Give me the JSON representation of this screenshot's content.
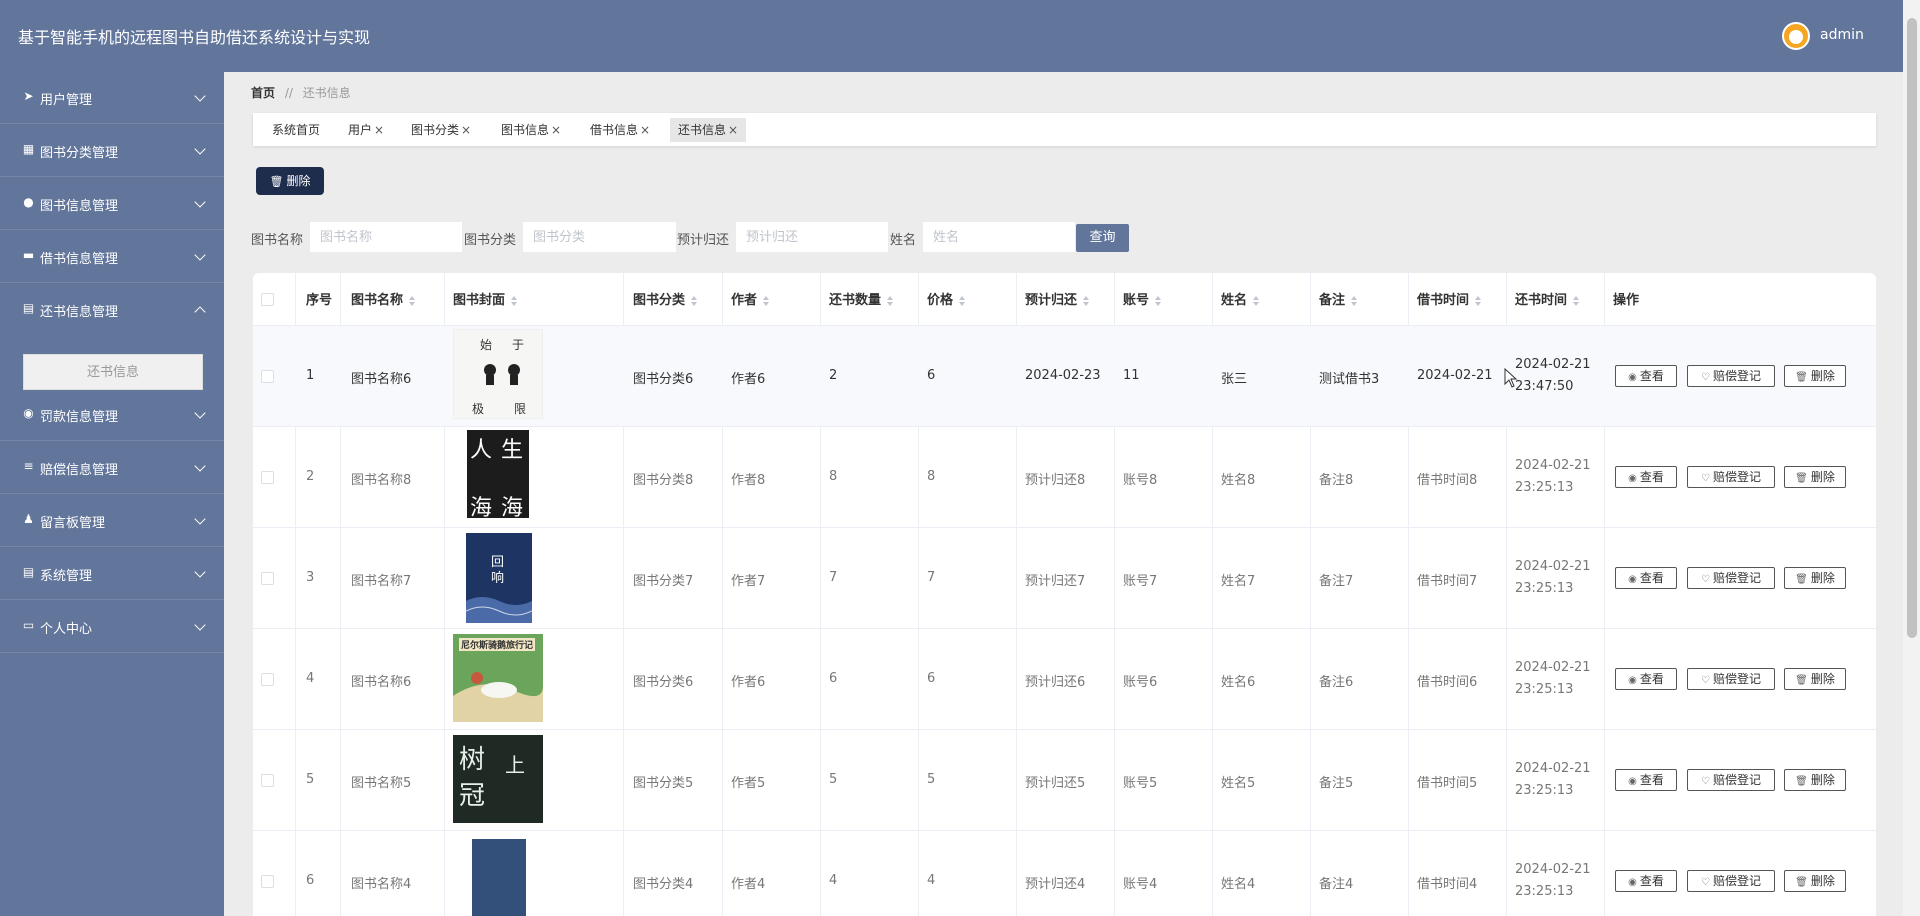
{
  "header": {
    "title": "基于智能手机的远程图书自助借还系统设计与实现",
    "username": "admin"
  },
  "sidebar": {
    "items": [
      {
        "label": "用户管理",
        "icon": "paper-plane-icon"
      },
      {
        "label": "图书分类管理",
        "icon": "grid-icon"
      },
      {
        "label": "图书信息管理",
        "icon": "map-pin-icon"
      },
      {
        "label": "借书信息管理",
        "icon": "flag-icon"
      },
      {
        "label": "还书信息管理",
        "icon": "clipboard-icon"
      },
      {
        "label": "罚款信息管理",
        "icon": "user-icon"
      },
      {
        "label": "赔偿信息管理",
        "icon": "menu-icon"
      },
      {
        "label": "留言板管理",
        "icon": "person-icon"
      },
      {
        "label": "系统管理",
        "icon": "clipboard-icon"
      },
      {
        "label": "个人中心",
        "icon": "card-icon"
      }
    ],
    "submenu": {
      "label": "还书信息"
    }
  },
  "breadcrumb": {
    "home": "首页",
    "sep": "//",
    "current": "还书信息"
  },
  "tabs": [
    {
      "label": "系统首页"
    },
    {
      "label": "用户"
    },
    {
      "label": "图书分类"
    },
    {
      "label": "图书信息"
    },
    {
      "label": "借书信息"
    },
    {
      "label": "还书信息"
    }
  ],
  "tab_close": "×",
  "toolbar": {
    "delete_label": "删除"
  },
  "search": {
    "book_name_label": "图书名称",
    "book_name_placeholder": "图书名称",
    "category_label": "图书分类",
    "category_placeholder": "图书分类",
    "due_label": "预计归还",
    "due_placeholder": "预计归还",
    "name_label": "姓名",
    "name_placeholder": "姓名",
    "query_label": "查询"
  },
  "table": {
    "headers": {
      "index": "序号",
      "book_name": "图书名称",
      "cover": "图书封面",
      "category": "图书分类",
      "author": "作者",
      "return_qty": "还书数量",
      "price": "价格",
      "due": "预计归还",
      "account": "账号",
      "name": "姓名",
      "note": "备注",
      "borrow_time": "借书时间",
      "return_time": "还书时间",
      "ops": "操作"
    },
    "rows": [
      {
        "index": "1",
        "book_name": "图书名称6",
        "category": "图书分类6",
        "author": "作者6",
        "return_qty": "2",
        "price": "6",
        "due": "2024-02-23",
        "account": "11",
        "name": "张三",
        "note": "测试借书3",
        "borrow_time": "2024-02-21",
        "return_time": "2024-02-21 23:47:50",
        "cover": {
          "c1": "始",
          "c2": "于",
          "c3": "极",
          "c4": "限"
        }
      },
      {
        "index": "2",
        "book_name": "图书名称8",
        "category": "图书分类8",
        "author": "作者8",
        "return_qty": "8",
        "price": "8",
        "due": "预计归还8",
        "account": "账号8",
        "name": "姓名8",
        "note": "备注8",
        "borrow_time": "借书时间8",
        "return_time": "2024-02-21 23:25:13",
        "cover": {
          "c1": "人",
          "c2": "生",
          "c3": "海",
          "c4": "海"
        }
      },
      {
        "index": "3",
        "book_name": "图书名称7",
        "category": "图书分类7",
        "author": "作者7",
        "return_qty": "7",
        "price": "7",
        "due": "预计归还7",
        "account": "账号7",
        "name": "姓名7",
        "note": "备注7",
        "borrow_time": "借书时间7",
        "return_time": "2024-02-21 23:25:13",
        "cover": {
          "c1": "回",
          "c2": "响"
        }
      },
      {
        "index": "4",
        "book_name": "图书名称6",
        "category": "图书分类6",
        "author": "作者6",
        "return_qty": "6",
        "price": "6",
        "due": "预计归还6",
        "account": "账号6",
        "name": "姓名6",
        "note": "备注6",
        "borrow_time": "借书时间6",
        "return_time": "2024-02-21 23:25:13",
        "cover": {
          "c1": "尼尔斯骑鹅旅行记"
        }
      },
      {
        "index": "5",
        "book_name": "图书名称5",
        "category": "图书分类5",
        "author": "作者5",
        "return_qty": "5",
        "price": "5",
        "due": "预计归还5",
        "account": "账号5",
        "name": "姓名5",
        "note": "备注5",
        "borrow_time": "借书时间5",
        "return_time": "2024-02-21 23:25:13",
        "cover": {
          "c1": "树",
          "c2": "上",
          "c3": "冠"
        }
      },
      {
        "index": "6",
        "book_name": "图书名称4",
        "category": "图书分类4",
        "author": "作者4",
        "return_qty": "4",
        "price": "4",
        "due": "预计归还4",
        "account": "账号4",
        "name": "姓名4",
        "note": "备注4",
        "borrow_time": "借书时间4",
        "return_time": "2024-02-21 23:25:13",
        "cover": {}
      }
    ],
    "ops": {
      "view": "查看",
      "compensate": "赔偿登记",
      "delete": "删除"
    }
  }
}
